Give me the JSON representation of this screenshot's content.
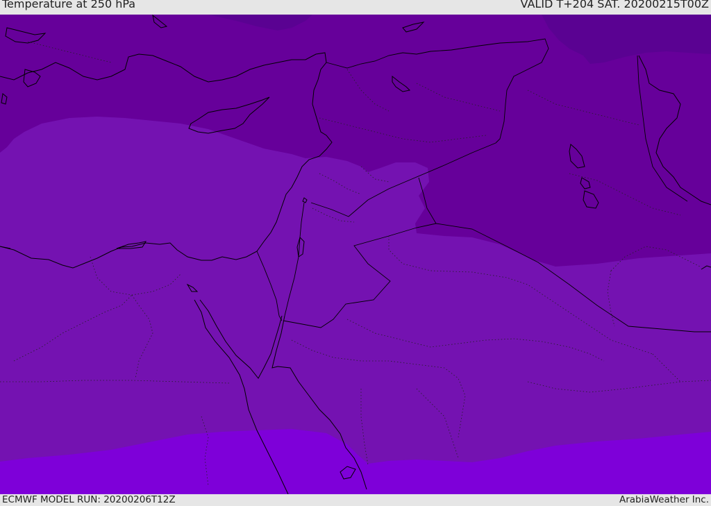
{
  "header": {
    "title": "Temperature at 250 hPa",
    "valid": "VALID T+204 SAT. 20200215T00Z"
  },
  "footer": {
    "model_run": "ECMWF MODEL RUN: 20200206T12Z",
    "credit": "ArabiaWeather Inc."
  },
  "colors": {
    "band_darkest": "#5a0292",
    "band_dark": "#66009a",
    "band_mid": "#7412b1",
    "band_light": "#7e00d9",
    "coastline": "#000000",
    "border": "#000000"
  }
}
